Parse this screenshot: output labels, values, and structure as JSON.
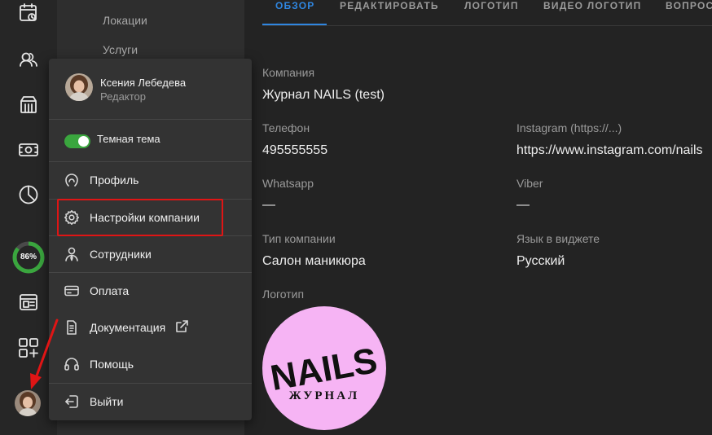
{
  "subnav": {
    "items": [
      "Локации",
      "Услуги"
    ]
  },
  "rail": {
    "icons": [
      "calendar-clock-icon",
      "clients-icon",
      "shop-icon",
      "cash-icon",
      "pie-chart-icon",
      "widget-icon",
      "apps-add-icon"
    ],
    "progress_percent": 86,
    "progress_label": "86%"
  },
  "tabs": [
    {
      "label": "ОБЗОР",
      "active": true
    },
    {
      "label": "РЕДАКТИРОВАТЬ",
      "active": false
    },
    {
      "label": "ЛОГОТИП",
      "active": false
    },
    {
      "label": "ВИДЕО ЛОГОТИП",
      "active": false
    },
    {
      "label": "ВОПРОС",
      "active": false
    }
  ],
  "fields": {
    "company": {
      "label": "Компания",
      "value": "Журнал NAILS (test)"
    },
    "phone": {
      "label": "Телефон",
      "value": "495555555"
    },
    "instagram": {
      "label": "Instagram (https://...)",
      "value": "https://www.instagram.com/nails"
    },
    "whatsapp": {
      "label": "Whatsapp",
      "value": "—"
    },
    "viber": {
      "label": "Viber",
      "value": "—"
    },
    "company_type": {
      "label": "Тип компании",
      "value": "Салон маникюра"
    },
    "widget_language": {
      "label": "Язык в виджете",
      "value": "Русский"
    },
    "logo": {
      "label": "Логотип"
    }
  },
  "logo": {
    "main_text": "NAILS",
    "sub_text": "ЖУРНАЛ",
    "background": "#f6b4f4"
  },
  "menu": {
    "user_name": "Ксения Лебедева",
    "user_role": "Редактор",
    "dark_theme_label": "Темная тема",
    "dark_theme_on": true,
    "items": [
      {
        "label": "Профиль",
        "icon": "profile-icon"
      },
      {
        "label": "Настройки компании",
        "icon": "gear-icon"
      },
      {
        "label": "Сотрудники",
        "icon": "staff-icon"
      },
      {
        "label": "Оплата",
        "icon": "credit-card-icon"
      },
      {
        "label": "Документация",
        "icon": "document-icon"
      },
      {
        "label": "Помощь",
        "icon": "headset-icon"
      },
      {
        "label": "Выйти",
        "icon": "logout-icon"
      }
    ]
  },
  "colors": {
    "accent": "#2f86e0",
    "toggle_on": "#3aa63e",
    "highlight": "#e01515",
    "progress": "#3aa63e"
  }
}
